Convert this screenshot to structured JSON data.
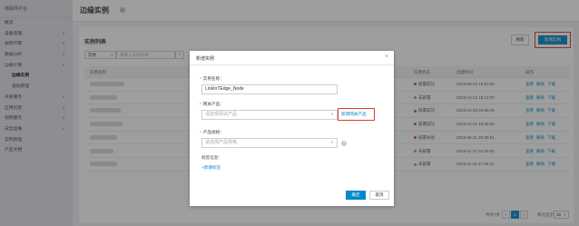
{
  "sidebar": {
    "header": "物联网平台",
    "items": [
      {
        "label": "概览",
        "chev": "",
        "sub": false,
        "active": false
      },
      {
        "label": "设备管理",
        "chev": "∨",
        "sub": false,
        "active": false
      },
      {
        "label": "规则引擎",
        "chev": "∨",
        "sub": false,
        "active": false
      },
      {
        "label": "数据分析",
        "chev": "∨",
        "sub": false,
        "active": false
      },
      {
        "label": "边缘计算",
        "chev": "∧",
        "sub": false,
        "active": false
      },
      {
        "label": "边缘实例",
        "chev": "",
        "sub": true,
        "active": true
      },
      {
        "label": "驱动管理",
        "chev": "",
        "sub": true,
        "active": false
      },
      {
        "label": "开发服务",
        "chev": "∨",
        "sub": false,
        "active": false
      },
      {
        "label": "应用托管",
        "chev": "∨",
        "sub": false,
        "active": false
      },
      {
        "label": "视频服务",
        "chev": "∨",
        "sub": false,
        "active": false
      },
      {
        "label": "安全运维",
        "chev": "∨",
        "sub": false,
        "active": false
      },
      {
        "label": "实例管理",
        "chev": "",
        "sub": false,
        "active": false
      },
      {
        "label": "产品文档",
        "chev": "",
        "sub": false,
        "active": false
      }
    ]
  },
  "header": {
    "title": "边缘实例",
    "help_glyph": "?"
  },
  "list": {
    "title": "实例列表",
    "refresh_label": "刷新",
    "add_label": "新增实例",
    "filter_select": "实例",
    "filter_chev": "∨",
    "filter_placeholder": "请输入实例名称",
    "search_glyph": "⌕"
  },
  "table": {
    "columns": [
      "实例名称",
      "实例状态",
      "创建时间",
      "操作"
    ],
    "rows": [
      {
        "status": "部署成功",
        "status_color": "#2e9e4f",
        "created": "2019-03-12 15:51:20"
      },
      {
        "status": "未部署",
        "status_color": "#999999",
        "created": "2018-12-13 10:12:57"
      },
      {
        "status": "部署成功",
        "status_color": "#2e9e4f",
        "created": "2018-12-20 23:59:45"
      },
      {
        "status": "部署成功",
        "status_color": "#2e9e4f",
        "created": "2018-12-21 10:36:08"
      },
      {
        "status": "部署失败",
        "status_color": "#e53935",
        "created": "2016-09-21 20:26:51"
      },
      {
        "status": "未部署",
        "status_color": "#999999",
        "created": "2015-11-27 16:34:50"
      },
      {
        "status": "未部署",
        "status_color": "#999999",
        "created": "2015-11-16 17:29:21"
      }
    ],
    "ops": [
      "查看",
      "删除",
      "下载"
    ]
  },
  "pager": {
    "total": "共有7条",
    "prev": "<",
    "current": "1",
    "next": ">",
    "size_label": "每页显示:",
    "size": "15",
    "size_chev": "∨"
  },
  "modal": {
    "title": "新增实例",
    "close_glyph": "×",
    "req_mark": "*",
    "name_label": "实例名称：",
    "name_value": "LinkIoTEdge_Node",
    "product_label": "网关产品：",
    "product_placeholder": "请选择网关产品",
    "new_product_link": "新建网关产品",
    "spec_label": "产品规格：",
    "spec_placeholder": "请选择产品规格",
    "tag_label": "标签信息：",
    "add_tag_link": "+新增标签",
    "select_chev": "∨",
    "help_glyph": "?",
    "ok_label": "确定",
    "cancel_label": "取消"
  },
  "colors": {
    "accent": "#0088cc",
    "highlight": "#e53935"
  }
}
